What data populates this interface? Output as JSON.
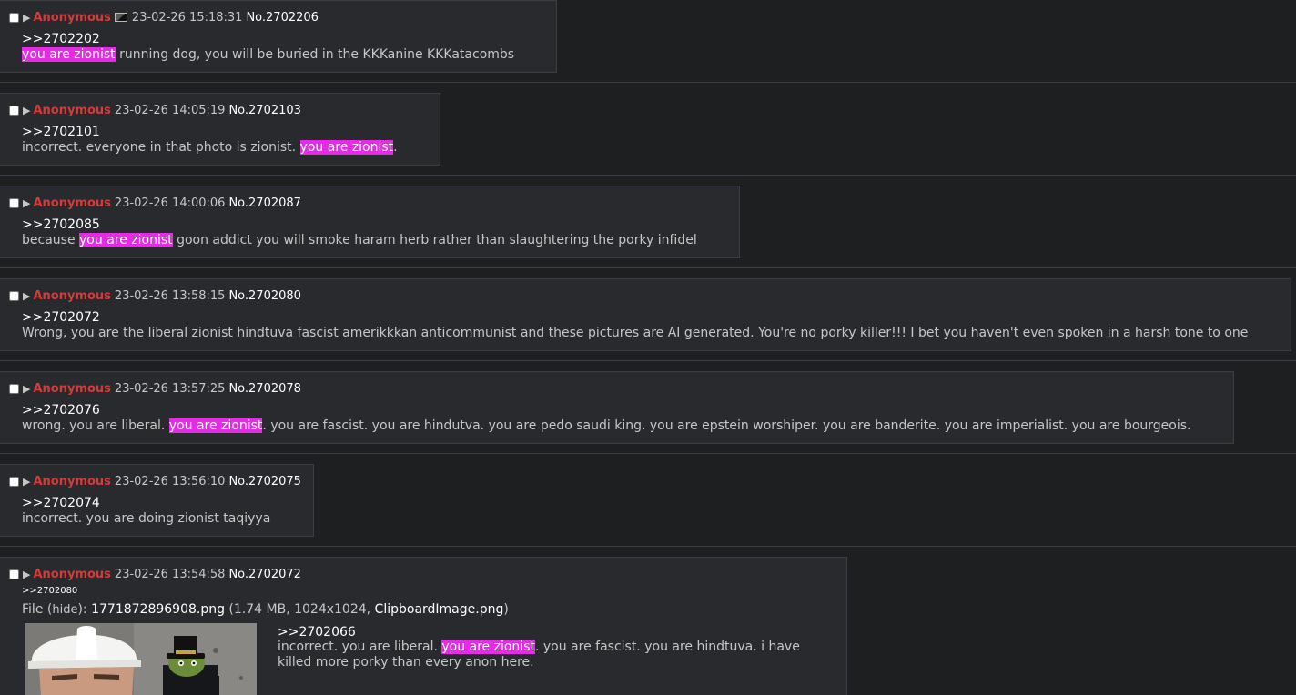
{
  "posts": [
    {
      "name": "Anonymous",
      "date": "23-02-26 15:18:31",
      "no": "No.2702206",
      "quote": ">>2702202",
      "body": {
        "pre": "",
        "hl": "you are zionist",
        "post": " running dog, you will be buried in the KKKanine KKKatacombs"
      }
    },
    {
      "name": "Anonymous",
      "date": "23-02-26 14:05:19",
      "no": "No.2702103",
      "quote": ">>2702101",
      "body": {
        "pre": "incorrect. everyone in that photo is zionist. ",
        "hl": "you are zionist",
        "post": "."
      }
    },
    {
      "name": "Anonymous",
      "date": "23-02-26 14:00:06",
      "no": "No.2702087",
      "quote": ">>2702085",
      "body": {
        "pre": "because ",
        "hl": "you are zionist",
        "post": " goon addict you will smoke haram herb rather than slaughtering the porky infidel"
      }
    },
    {
      "name": "Anonymous",
      "date": "23-02-26 13:58:15",
      "no": "No.2702080",
      "quote": ">>2702072",
      "body": {
        "pre": "Wrong, you are the liberal zionist hindtuva fascist amerikkkan anticommunist and these pictures are AI generated. You're no porky killer!!! I bet you haven't even spoken in a harsh tone to one",
        "hl": "",
        "post": ""
      }
    },
    {
      "name": "Anonymous",
      "date": "23-02-26 13:57:25",
      "no": "No.2702078",
      "quote": ">>2702076",
      "body": {
        "pre": "wrong. you are liberal. ",
        "hl": "you are zionist",
        "post": ". you are fascist. you are hindutva. you are pedo saudi king. you are epstein worshiper. you are banderite. you are imperialist. you are bourgeois."
      }
    },
    {
      "name": "Anonymous",
      "date": "23-02-26 13:56:10",
      "no": "No.2702075",
      "quote": ">>2702074",
      "body": {
        "pre": "incorrect. you are doing zionist taqiyya",
        "hl": "",
        "post": ""
      }
    },
    {
      "name": "Anonymous",
      "date": "23-02-26 13:54:58",
      "no": "No.2702072",
      "backlink": ">>2702080",
      "file": {
        "prefix": "File (",
        "hide": "hide",
        "mid": "): ",
        "filename": "1771872896908.png",
        "meta": " (1.74 MB, 1024x1024, ",
        "orig": "ClipboardImage.png",
        "close": ")"
      },
      "quote": ">>2702066",
      "body": {
        "pre": "incorrect. you are liberal. ",
        "hl": "you are zionist",
        "post": ". you are fascist. you are hindtuva. i have killed more porky than every anon here."
      }
    }
  ],
  "icons": {
    "expand": "triangle-right-icon",
    "flag": "country-flag-icon"
  },
  "colors": {
    "name": "#d13c3c",
    "highlight": "#e62be6",
    "post_bg": "#282a2e",
    "page_bg": "#1d1f21"
  }
}
